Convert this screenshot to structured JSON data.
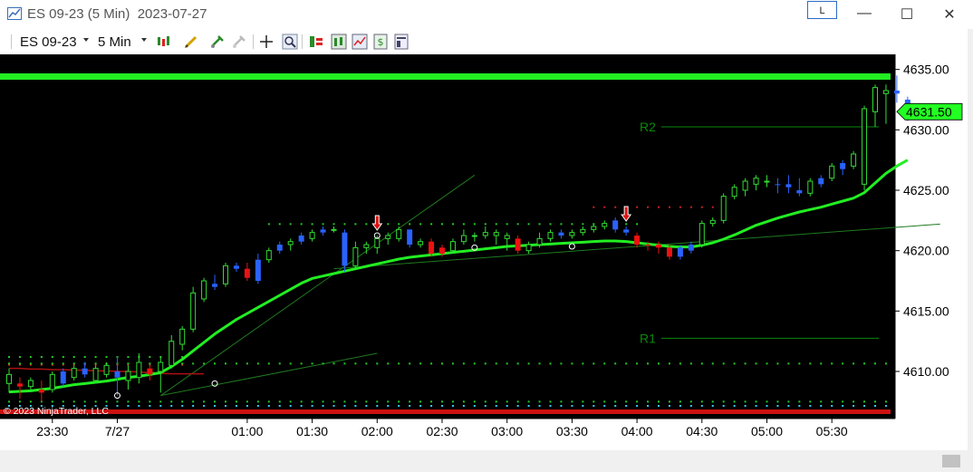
{
  "window": {
    "title": "ES 09-23 (5 Min)  2023-07-27",
    "link_button": "L",
    "minimize": "—",
    "maximize": "☐",
    "close": "✕"
  },
  "toolbar": {
    "instrument": "ES 09-23",
    "interval": "5 Min",
    "icons": [
      "bars-type-icon",
      "pencil-draw-icon",
      "magnet-icon",
      "pin-icon",
      "crosshair-icon",
      "zoom-icon",
      "data-series-icon",
      "indicators-icon",
      "strategies-icon",
      "chart-trader-icon",
      "properties-icon"
    ]
  },
  "colors": {
    "background": "#000000",
    "up_candle": "#33dd33",
    "down_candle": "#ee1111",
    "neutral_candle": "#2a62ff",
    "moving_average": "#22ee22",
    "red_band": "#aa1111",
    "trendline": "#1f7a1f",
    "pivot": "#0a8a0a",
    "price_marker": "#22ff22"
  },
  "chart_data": {
    "type": "candlestick",
    "instrument": "ES 09-23",
    "interval": "5 Min",
    "date": "2023-07-27",
    "ylim": [
      4607.0,
      4635.5
    ],
    "yticks": [
      "4635.00",
      "4630.00",
      "4625.00",
      "4620.00",
      "4615.00",
      "4610.00"
    ],
    "ytick_values": [
      4635,
      4630,
      4625,
      4620,
      4615,
      4610
    ],
    "xticks": [
      "23:30",
      "7/27",
      "01:00",
      "01:30",
      "02:00",
      "02:30",
      "03:00",
      "03:30",
      "04:00",
      "04:30",
      "05:00",
      "05:30"
    ],
    "xtick_bar_index": [
      4,
      10,
      22,
      28,
      34,
      40,
      46,
      52,
      58,
      64,
      70,
      76
    ],
    "last_price": "4631.50",
    "pivots": [
      {
        "label": "R2",
        "value": 4630.25
      },
      {
        "label": "R1",
        "value": 4612.75
      }
    ],
    "candles": [
      [
        4609.0,
        4610.25,
        4608.25,
        4609.75,
        "up"
      ],
      [
        4609.0,
        4609.5,
        4607.75,
        4608.75,
        "down"
      ],
      [
        4608.75,
        4609.5,
        4608.5,
        4609.25,
        "up"
      ],
      [
        4608.5,
        4609.25,
        4607.5,
        4608.25,
        "down"
      ],
      [
        4608.5,
        4610.0,
        4608.25,
        4609.75,
        "up"
      ],
      [
        4609.0,
        4610.25,
        4608.75,
        4610.0,
        "neutral"
      ],
      [
        4609.5,
        4610.5,
        4609.25,
        4610.25,
        "up"
      ],
      [
        4609.75,
        4610.75,
        4609.5,
        4610.25,
        "neutral"
      ],
      [
        4609.25,
        4610.5,
        4609.0,
        4610.25,
        "up"
      ],
      [
        4609.75,
        4610.75,
        4609.5,
        4610.5,
        "up"
      ],
      [
        4610.0,
        4611.25,
        4608.0,
        4609.5,
        "neutral"
      ],
      [
        4609.25,
        4610.5,
        4608.5,
        4610.0,
        "up"
      ],
      [
        4609.5,
        4611.5,
        4609.0,
        4610.75,
        "up"
      ],
      [
        4609.75,
        4610.5,
        4609.25,
        4610.25,
        "down"
      ],
      [
        4610.0,
        4611.25,
        4608.25,
        4610.75,
        "up"
      ],
      [
        4610.5,
        4613.0,
        4610.25,
        4612.5,
        "up"
      ],
      [
        4612.25,
        4613.75,
        4611.75,
        4613.5,
        "up"
      ],
      [
        4613.5,
        4617.0,
        4613.25,
        4616.5,
        "up"
      ],
      [
        4616.0,
        4617.75,
        4615.75,
        4617.5,
        "up"
      ],
      [
        4617.0,
        4618.0,
        4616.75,
        4617.25,
        "neutral"
      ],
      [
        4617.25,
        4619.0,
        4617.0,
        4618.75,
        "up"
      ],
      [
        4618.75,
        4619.0,
        4618.25,
        4618.5,
        "neutral"
      ],
      [
        4618.5,
        4619.0,
        4617.5,
        4617.75,
        "down"
      ],
      [
        4617.5,
        4619.75,
        4617.25,
        4619.25,
        "neutral"
      ],
      [
        4619.25,
        4620.25,
        4619.0,
        4620.0,
        "up"
      ],
      [
        4620.0,
        4620.75,
        4619.75,
        4620.5,
        "neutral"
      ],
      [
        4620.5,
        4621.0,
        4620.0,
        4620.75,
        "up"
      ],
      [
        4620.75,
        4621.5,
        4620.5,
        4621.25,
        "neutral"
      ],
      [
        4621.0,
        4621.75,
        4620.75,
        4621.5,
        "up"
      ],
      [
        4621.5,
        4622.0,
        4621.25,
        4621.75,
        "neutral"
      ],
      [
        4621.75,
        4622.0,
        4621.5,
        4621.75,
        "up"
      ],
      [
        4621.5,
        4621.75,
        4618.25,
        4618.75,
        "neutral"
      ],
      [
        4618.75,
        4620.75,
        4618.5,
        4620.25,
        "up"
      ],
      [
        4620.25,
        4620.75,
        4619.75,
        4620.5,
        "up"
      ],
      [
        4620.25,
        4621.25,
        4619.75,
        4621.0,
        "up"
      ],
      [
        4621.0,
        4621.5,
        4620.5,
        4621.25,
        "up"
      ],
      [
        4621.0,
        4622.0,
        4620.75,
        4621.75,
        "up"
      ],
      [
        4621.75,
        4621.75,
        4620.25,
        4620.5,
        "neutral"
      ],
      [
        4620.5,
        4621.0,
        4620.25,
        4620.75,
        "up"
      ],
      [
        4620.75,
        4621.0,
        4619.5,
        4619.75,
        "down"
      ],
      [
        4619.75,
        4620.5,
        4619.5,
        4620.25,
        "down"
      ],
      [
        4620.0,
        4621.0,
        4619.75,
        4620.75,
        "up"
      ],
      [
        4620.75,
        4621.75,
        4620.5,
        4621.25,
        "up"
      ],
      [
        4621.25,
        4621.5,
        4620.75,
        4621.25,
        "up"
      ],
      [
        4621.25,
        4622.0,
        4621.0,
        4621.5,
        "up"
      ],
      [
        4621.5,
        4621.75,
        4620.5,
        4621.25,
        "up"
      ],
      [
        4621.25,
        4621.5,
        4620.0,
        4621.0,
        "up"
      ],
      [
        4621.0,
        4621.25,
        4619.75,
        4620.0,
        "down"
      ],
      [
        4620.0,
        4620.75,
        4619.75,
        4620.5,
        "up"
      ],
      [
        4620.5,
        4621.5,
        4620.25,
        4621.0,
        "up"
      ],
      [
        4621.0,
        4621.75,
        4620.75,
        4621.5,
        "up"
      ],
      [
        4621.5,
        4621.75,
        4621.0,
        4621.25,
        "neutral"
      ],
      [
        4621.25,
        4621.75,
        4621.0,
        4621.5,
        "up"
      ],
      [
        4621.5,
        4622.0,
        4621.25,
        4621.75,
        "up"
      ],
      [
        4621.75,
        4622.25,
        4621.5,
        4622.0,
        "up"
      ],
      [
        4622.0,
        4622.5,
        4621.75,
        4622.25,
        "up"
      ],
      [
        4622.5,
        4622.75,
        4621.5,
        4621.75,
        "neutral"
      ],
      [
        4621.75,
        4622.0,
        4621.25,
        4621.5,
        "neutral"
      ],
      [
        4621.25,
        4621.5,
        4620.25,
        4620.5,
        "down"
      ],
      [
        4620.5,
        4620.75,
        4620.0,
        4620.5,
        "down"
      ],
      [
        4620.5,
        4620.75,
        4619.75,
        4620.25,
        "down"
      ],
      [
        4620.25,
        4620.5,
        4619.25,
        4619.5,
        "down"
      ],
      [
        4619.5,
        4620.5,
        4619.25,
        4620.25,
        "neutral"
      ],
      [
        4620.0,
        4620.75,
        4619.75,
        4620.5,
        "neutral"
      ],
      [
        4620.5,
        4622.5,
        4620.25,
        4622.25,
        "up"
      ],
      [
        4622.25,
        4622.75,
        4622.0,
        4622.5,
        "up"
      ],
      [
        4622.5,
        4624.75,
        4622.25,
        4624.5,
        "up"
      ],
      [
        4624.5,
        4625.5,
        4624.25,
        4625.25,
        "up"
      ],
      [
        4625.0,
        4626.0,
        4624.5,
        4625.75,
        "up"
      ],
      [
        4625.5,
        4626.25,
        4625.0,
        4626.0,
        "up"
      ],
      [
        4625.75,
        4626.25,
        4625.25,
        4625.75,
        "up"
      ],
      [
        4625.5,
        4626.0,
        4624.75,
        4625.5,
        "neutral"
      ],
      [
        4625.5,
        4626.25,
        4624.75,
        4625.25,
        "neutral"
      ],
      [
        4625.0,
        4626.0,
        4624.5,
        4624.75,
        "neutral"
      ],
      [
        4624.75,
        4626.0,
        4624.5,
        4625.75,
        "up"
      ],
      [
        4625.5,
        4626.25,
        4625.25,
        4626.0,
        "neutral"
      ],
      [
        4626.0,
        4627.25,
        4625.75,
        4627.0,
        "up"
      ],
      [
        4626.75,
        4627.5,
        4626.25,
        4627.25,
        "neutral"
      ],
      [
        4627.0,
        4628.25,
        4626.75,
        4628.0,
        "up"
      ],
      [
        4625.5,
        4632.0,
        4625.0,
        4631.75,
        "up"
      ],
      [
        4631.5,
        4633.75,
        4630.25,
        4633.5,
        "up"
      ],
      [
        4633.0,
        4633.75,
        4630.5,
        4633.25,
        "up"
      ],
      [
        4633.25,
        4634.5,
        4632.25,
        4633.0,
        "neutral"
      ],
      [
        4632.5,
        4632.75,
        4630.75,
        4631.5,
        "neutral"
      ]
    ],
    "moving_average": [
      4608.3,
      4608.35,
      4608.4,
      4608.5,
      4608.6,
      4608.75,
      4608.9,
      4609.0,
      4609.1,
      4609.2,
      4609.35,
      4609.5,
      4609.6,
      4609.75,
      4609.9,
      4610.4,
      4611.0,
      4611.7,
      4612.4,
      4613.1,
      4613.7,
      4614.3,
      4614.8,
      4615.3,
      4615.8,
      4616.3,
      4616.8,
      4617.3,
      4617.7,
      4617.9,
      4618.1,
      4618.3,
      4618.5,
      4618.7,
      4618.9,
      4619.1,
      4619.3,
      4619.45,
      4619.55,
      4619.65,
      4619.75,
      4619.85,
      4619.95,
      4620.05,
      4620.15,
      4620.25,
      4620.35,
      4620.4,
      4620.45,
      4620.5,
      4620.55,
      4620.6,
      4620.65,
      4620.7,
      4620.75,
      4620.8,
      4620.8,
      4620.75,
      4620.65,
      4620.55,
      4620.45,
      4620.35,
      4620.3,
      4620.3,
      4620.45,
      4620.65,
      4620.95,
      4621.3,
      4621.7,
      4622.1,
      4622.4,
      4622.7,
      4622.95,
      4623.2,
      4623.4,
      4623.6,
      4623.85,
      4624.1,
      4624.35,
      4624.8,
      4625.6,
      4626.4,
      4627.0,
      4627.5
    ],
    "red_band": [
      4610.25,
      4610.25,
      4610.2,
      4610.2,
      4610.15,
      4610.15,
      4610.1,
      4610.1,
      4610.05,
      4610.05,
      4610.0,
      4610.0,
      4609.95,
      4609.9,
      4609.85,
      4609.8,
      4609.8,
      4609.8,
      4609.8
    ],
    "dot_rows": [
      {
        "value": 4611.2,
        "from": 0,
        "to": 16,
        "kind": "green"
      },
      {
        "value": 4610.55,
        "from": 0,
        "to": 16,
        "kind": "red"
      },
      {
        "value": 4610.65,
        "from": 0,
        "to": 86,
        "kind": "green"
      },
      {
        "value": 4607.5,
        "from": 0,
        "to": 86,
        "kind": "green"
      },
      {
        "value": 4607.15,
        "from": 0,
        "to": 86,
        "kind": "cyan"
      },
      {
        "value": 4622.2,
        "from": 24,
        "to": 58,
        "kind": "green"
      },
      {
        "value": 4623.6,
        "from": 54,
        "to": 66,
        "kind": "red"
      }
    ],
    "trend_lines": [
      {
        "from": [
          14,
          4608.0
        ],
        "to": [
          43,
          4626.25
        ]
      },
      {
        "from": [
          14,
          4608.0
        ],
        "to": [
          34,
          4611.5
        ]
      },
      {
        "from": [
          30,
          4618.5
        ],
        "to": [
          86,
          4622.2
        ]
      }
    ],
    "signal_arrows": [
      34,
      57
    ],
    "swing_circles": [
      [
        10,
        4608.0
      ],
      [
        19,
        4609.0
      ],
      [
        34,
        4621.25
      ],
      [
        43,
        4620.25
      ],
      [
        52,
        4620.35
      ]
    ],
    "copyright": "© 2023 NinjaTrader, LLC"
  }
}
